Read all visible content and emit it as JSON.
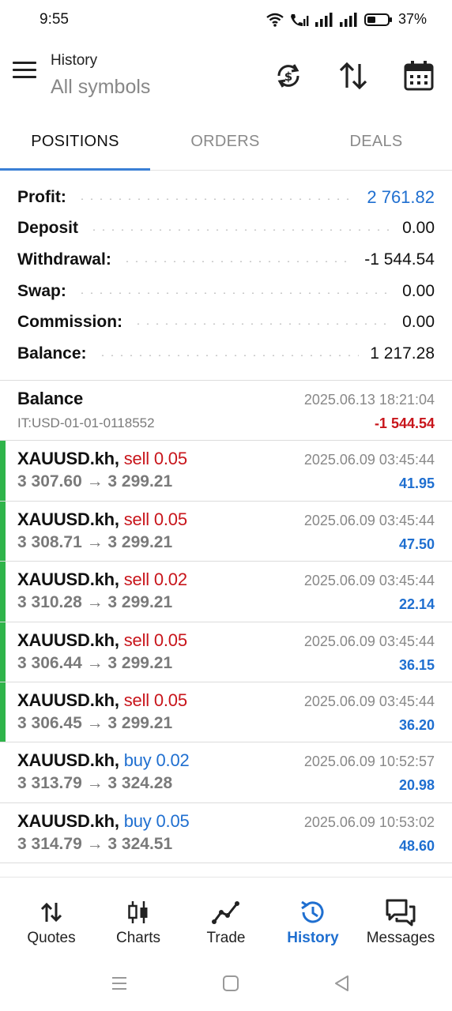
{
  "status_bar": {
    "time": "9:55",
    "battery": "37%",
    "icons": [
      "wifi-icon",
      "wifi-call-icon",
      "signal-icon",
      "signal-icon",
      "battery-icon"
    ]
  },
  "header": {
    "title": "History",
    "subtitle": "All symbols",
    "icons": [
      "currency-exchange-icon",
      "sort-icon",
      "calendar-icon"
    ]
  },
  "tabs": [
    {
      "label": "POSITIONS",
      "active": true
    },
    {
      "label": "ORDERS",
      "active": false
    },
    {
      "label": "DEALS",
      "active": false
    }
  ],
  "summary": [
    {
      "label": "Profit:",
      "value": "2 761.82",
      "color": "#1f6fd0"
    },
    {
      "label": "Deposit",
      "value": "0.00"
    },
    {
      "label": "Withdrawal:",
      "value": "-1 544.54"
    },
    {
      "label": "Swap:",
      "value": "0.00"
    },
    {
      "label": "Commission:",
      "value": "0.00"
    },
    {
      "label": "Balance:",
      "value": "1 217.28"
    }
  ],
  "balance_entry": {
    "title": "Balance",
    "sub": "IT:USD-01-01-0118552",
    "time": "2025.06.13 18:21:04",
    "amount": "-1 544.54"
  },
  "positions": [
    {
      "symbol": "XAUUSD.kh,",
      "direction": "sell 0.05",
      "prices": "3 307.60 → 3 299.21",
      "time": "2025.06.09 03:45:44",
      "profit": "41.95"
    },
    {
      "symbol": "XAUUSD.kh,",
      "direction": "sell 0.05",
      "prices": "3 308.71 → 3 299.21",
      "time": "2025.06.09 03:45:44",
      "profit": "47.50"
    },
    {
      "symbol": "XAUUSD.kh,",
      "direction": "sell 0.02",
      "prices": "3 310.28 → 3 299.21",
      "time": "2025.06.09 03:45:44",
      "profit": "22.14"
    },
    {
      "symbol": "XAUUSD.kh,",
      "direction": "sell 0.05",
      "prices": "3 306.44 → 3 299.21",
      "time": "2025.06.09 03:45:44",
      "profit": "36.15"
    },
    {
      "symbol": "XAUUSD.kh,",
      "direction": "sell 0.05",
      "prices": "3 306.45 → 3 299.21",
      "time": "2025.06.09 03:45:44",
      "profit": "36.20"
    },
    {
      "symbol": "XAUUSD.kh,",
      "direction": "buy 0.02",
      "prices": "3 313.79 → 3 324.28",
      "time": "2025.06.09 10:52:57",
      "profit": "20.98"
    },
    {
      "symbol": "XAUUSD.kh,",
      "direction": "buy 0.05",
      "prices": "3 314.79 → 3 324.51",
      "time": "2025.06.09 10:53:02",
      "profit": "48.60"
    }
  ],
  "bottom_nav": [
    {
      "label": "Quotes",
      "icon": "quotes-icon"
    },
    {
      "label": "Charts",
      "icon": "charts-icon"
    },
    {
      "label": "Trade",
      "icon": "trade-icon"
    },
    {
      "label": "History",
      "icon": "history-icon",
      "active": true
    },
    {
      "label": "Messages",
      "icon": "messages-icon"
    }
  ],
  "colors": {
    "accent": "#1f6fd0",
    "sell": "#c8151b",
    "buy": "#1f6fd0",
    "position_bar": "#2fb44a"
  }
}
